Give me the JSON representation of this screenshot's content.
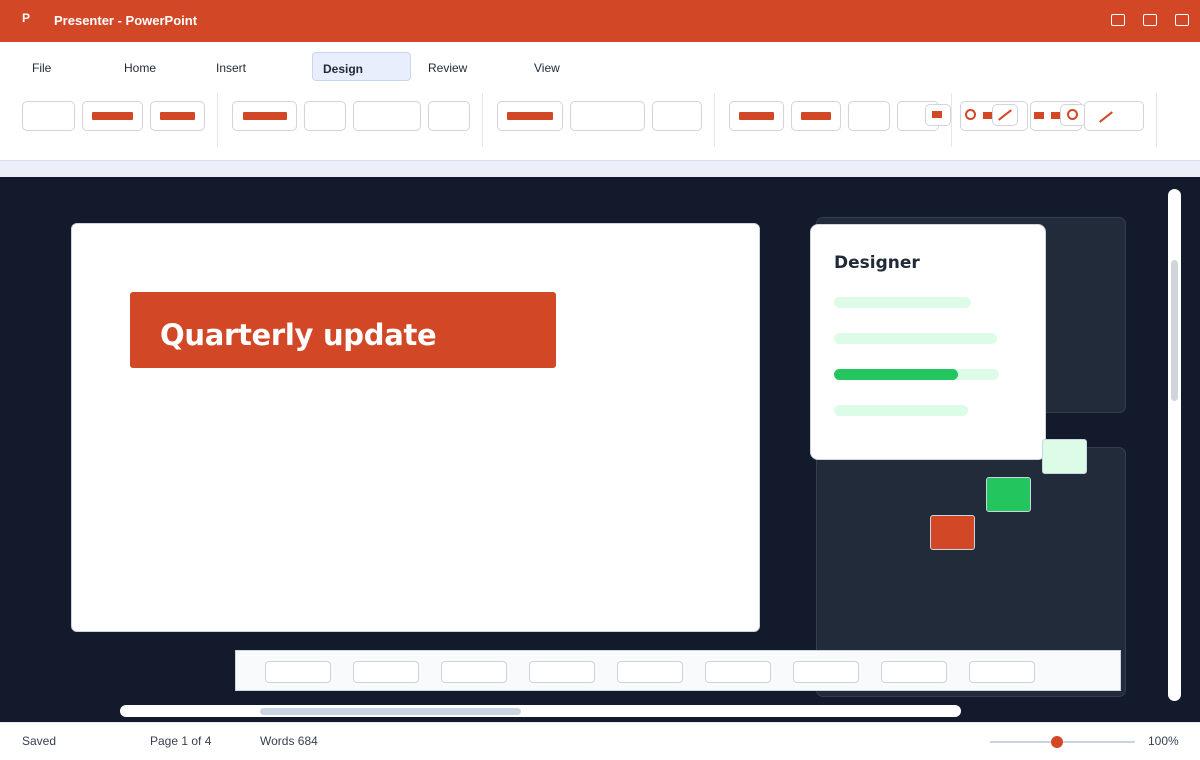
{
  "app": {
    "logo_letter": "P",
    "title": "Presenter - PowerPoint",
    "accent_color": "#d24726"
  },
  "window_controls": [
    "minimize-icon",
    "maximize-icon",
    "close-icon"
  ],
  "tabs": [
    {
      "label": "File"
    },
    {
      "label": "Home"
    },
    {
      "label": "Insert"
    },
    {
      "label": "Design",
      "active": true
    },
    {
      "label": "Review"
    },
    {
      "label": "View"
    }
  ],
  "slide": {
    "title": "Quarterly update"
  },
  "designer": {
    "title": "Designer",
    "levels": [
      0,
      0,
      0.75,
      0
    ],
    "fill_color": "#22c55e",
    "track_color": "#dcfce7"
  },
  "swatches": [
    "#dcfce7",
    "#22c55e",
    "#d24726"
  ],
  "status": {
    "saved": "Saved",
    "page": "Page 1 of 4",
    "words": "Words 684",
    "zoom": "100%",
    "zoom_level": 0.5
  }
}
